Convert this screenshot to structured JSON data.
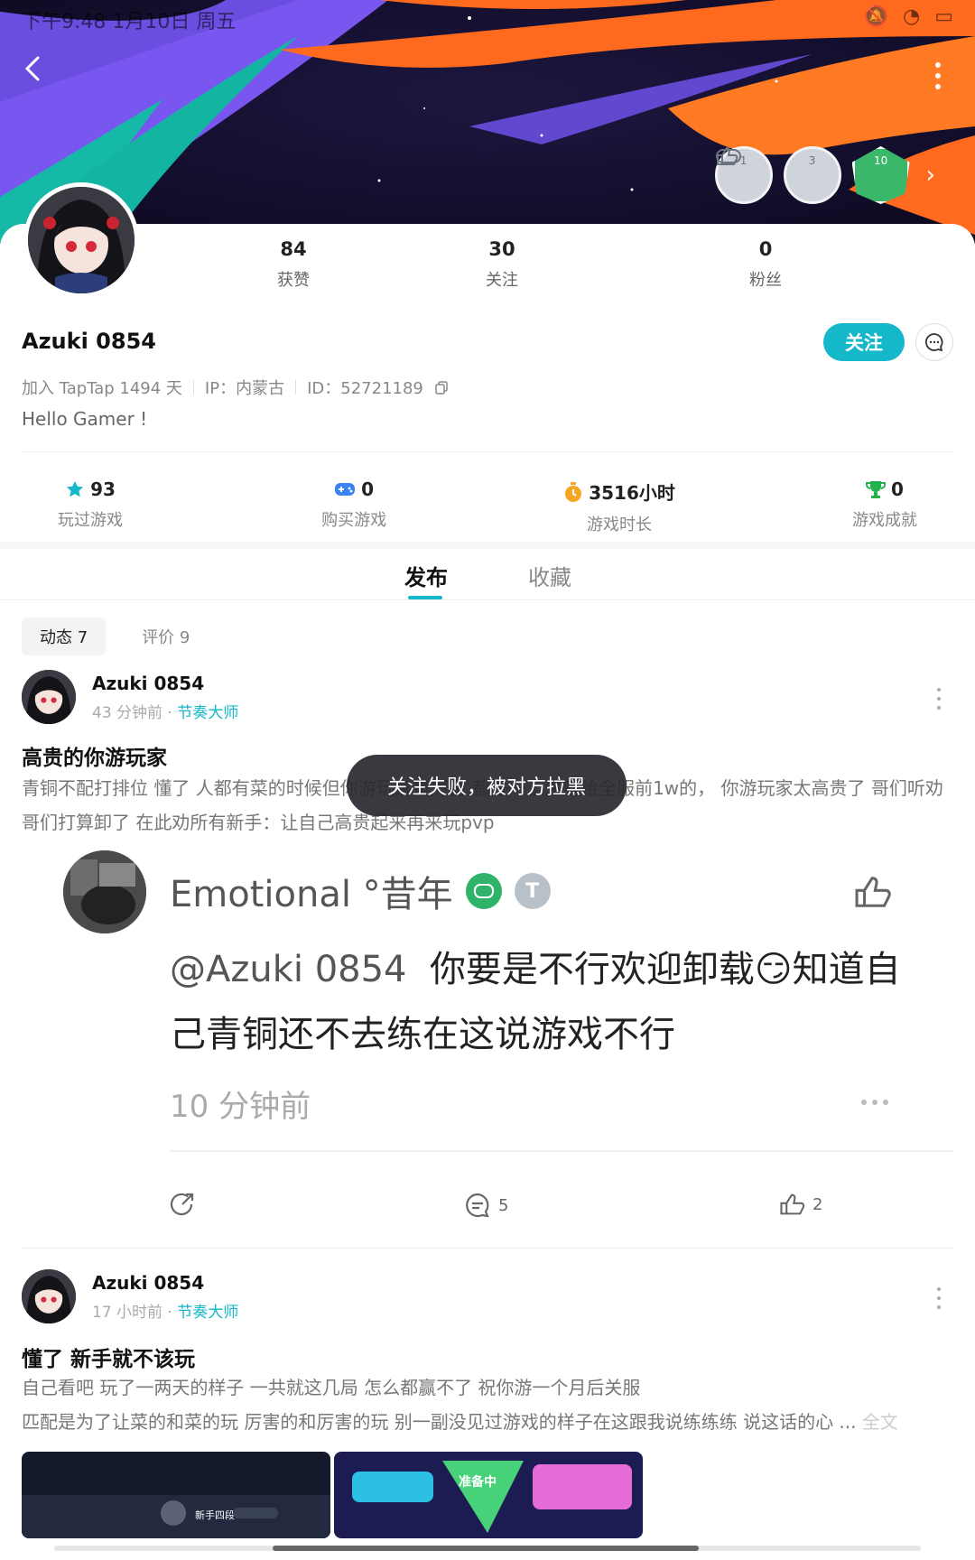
{
  "status_bar": {
    "time": "下午9:48 1月10日 周五"
  },
  "profile": {
    "name": "Azuki 0854",
    "stats": [
      {
        "num": "84",
        "label": "获赞"
      },
      {
        "num": "30",
        "label": "关注"
      },
      {
        "num": "0",
        "label": "粉丝"
      }
    ],
    "follow_label": "关注",
    "join": "加入 TapTap 1494 天",
    "ip": "IP：内蒙古",
    "id": "ID：52721189",
    "bio": "Hello Gamer !",
    "badges": [
      "1",
      "3",
      "10"
    ]
  },
  "game_stats": [
    {
      "num": "93",
      "label": "玩过游戏",
      "icon": "star-icon",
      "color": "#14b8c8"
    },
    {
      "num": "0",
      "label": "购买游戏",
      "icon": "gamepad-icon",
      "color": "#3b82f6"
    },
    {
      "num": "3516小时",
      "label": "游戏时长",
      "icon": "timer-icon",
      "color": "#f5a623"
    },
    {
      "num": "0",
      "label": "游戏成就",
      "icon": "trophy-icon",
      "color": "#22b24c"
    }
  ],
  "tabs": {
    "active": "发布",
    "inactive": "收藏"
  },
  "subtabs": [
    {
      "label": "动态 7"
    },
    {
      "label": "评价 9"
    }
  ],
  "posts": [
    {
      "author": "Azuki 0854",
      "time": "43 分钟前 · ",
      "tag": "节奏大师",
      "title": "高贵的你游玩家",
      "body": "青铜不配打排位 懂了 人都有菜的时候但你游玩家是厉害 都是一上来就给全服前1w的， 你游玩家太高贵了 哥们听劝 哥们打算卸了 在此劝所有新手：让自己高贵起来再来玩pvp",
      "quote": {
        "user": "Emotional °昔年",
        "mention": "@Azuki 0854",
        "text": "你要是不行欢迎卸载😏知道自己青铜还不去练在这说游戏不行",
        "time": "10 分钟前"
      },
      "comments": "5",
      "likes": "2"
    },
    {
      "author": "Azuki 0854",
      "time": "17 小时前 · ",
      "tag": "节奏大师",
      "title": "懂了 新手就不该玩",
      "body1": "自己看吧 玩了一两天的样子 一共就这几局 怎么都赢不了 祝你游一个月后关服",
      "body2": "匹配是为了让菜的和菜的玩 厉害的和厉害的玩 别一副没见过游戏的样子在这跟我说练练练 说这话的心 ...",
      "more": "全文",
      "thumb1_label": "新手四段",
      "thumb2_label": "准备中"
    }
  ],
  "toast": "关注失败，被对方拉黑"
}
